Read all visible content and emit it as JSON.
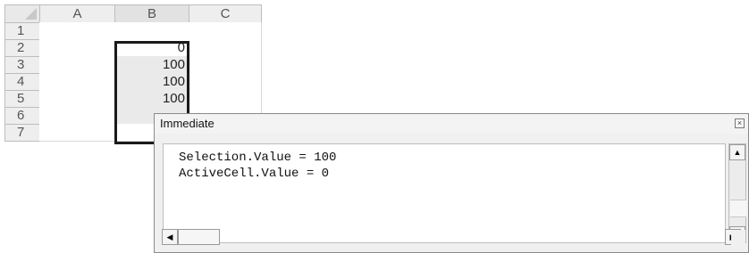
{
  "spreadsheet": {
    "columns": [
      "A",
      "B",
      "C"
    ],
    "rows": [
      "1",
      "2",
      "3",
      "4",
      "5",
      "6",
      "7"
    ],
    "column_b_values": [
      "",
      "0",
      "100",
      "100",
      "100",
      "",
      ""
    ]
  },
  "immediate": {
    "title": "Immediate",
    "lines": [
      "Selection.Value = 100",
      "ActiveCell.Value = 0"
    ],
    "close_icon": "close-icon",
    "up_icon": "arrow-up-icon",
    "down_icon": "arrow-down-icon",
    "left_icon": "arrow-left-icon",
    "right_icon": "arrow-right-icon"
  }
}
